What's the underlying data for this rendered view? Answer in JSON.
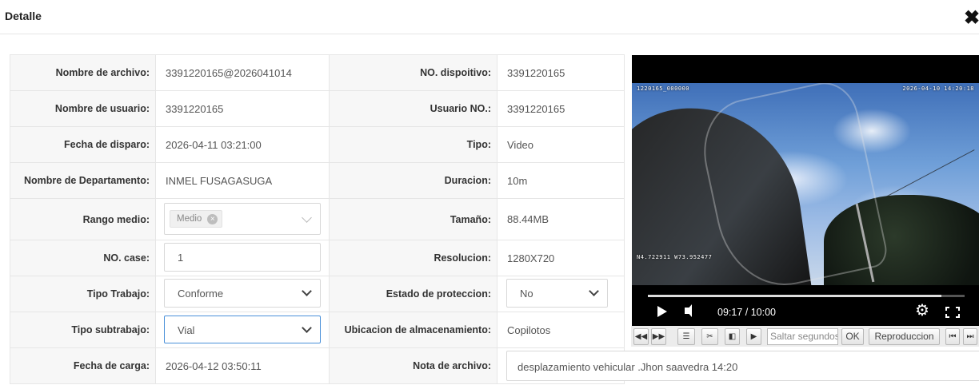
{
  "dialog": {
    "title": "Detalle",
    "close_icon": "close-icon"
  },
  "fields": {
    "nombre_archivo": {
      "label": "Nombre de archivo:",
      "value": "3391220165@2026041014"
    },
    "no_dispositivo": {
      "label": "NO. dispoitivo:",
      "value": "3391220165"
    },
    "nombre_usuario": {
      "label": "Nombre de usuario:",
      "value": "3391220165"
    },
    "usuario_no": {
      "label": "Usuario NO.:",
      "value": "3391220165"
    },
    "fecha_disparo": {
      "label": "Fecha de disparo:",
      "value": "2026-04-11 03:21:00"
    },
    "tipo": {
      "label": "Tipo:",
      "value": "Video"
    },
    "departamento": {
      "label": "Nombre de Departamento:",
      "value": "INMEL FUSAGASUGA"
    },
    "duracion": {
      "label": "Duracion:",
      "value": "10m"
    },
    "rango_medio": {
      "label": "Rango medio:",
      "tag": "Medio"
    },
    "tamano": {
      "label": "Tamaño:",
      "value": "88.44MB"
    },
    "no_case": {
      "label": "NO. case:",
      "value": "1"
    },
    "resolucion": {
      "label": "Resolucion:",
      "value": "1280X720"
    },
    "tipo_trabajo": {
      "label": "Tipo Trabajo:",
      "value": "Conforme"
    },
    "estado_proteccion": {
      "label": "Estado de proteccion:",
      "value": "No"
    },
    "tipo_subtrabajo": {
      "label": "Tipo subtrabajo:",
      "value": "Vial"
    },
    "ubicacion": {
      "label": "Ubicacion de almacenamiento:",
      "value": "Copilotos"
    },
    "fecha_carga": {
      "label": "Fecha de carga:",
      "value": "2026-04-12 03:50:11"
    },
    "nota_archivo": {
      "label": "Nota de archivo:",
      "value": "desplazamiento vehicular .Jhon saavedra 14:20"
    }
  },
  "player": {
    "osd_id": "1220165_000000",
    "osd_timestamp": "2026-04-10 14:20:18",
    "osd_gps": "N4.722911 W73.952477",
    "time": "09:17 / 10:00",
    "progress": 0.928
  },
  "toolbar": {
    "seek_placeholder": "Saltar segundos",
    "ok_label": "OK",
    "replay_label": "Reproduccion"
  }
}
